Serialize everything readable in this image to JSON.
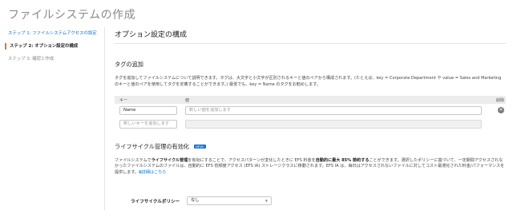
{
  "page": {
    "title": "ファイルシステムの作成"
  },
  "steps": [
    {
      "label": "ステップ 1: ファイルシステムアクセスの設定",
      "state": "link"
    },
    {
      "label": "ステップ 2: オプション設定の構成",
      "state": "active"
    },
    {
      "label": "ステップ 3: 確認と作成",
      "state": "muted"
    }
  ],
  "section": {
    "title": "オプション設定の構成"
  },
  "tags": {
    "title": "タグの追加",
    "description": "タグを追加してファイルシステムについて説明できます。タグは、大文字と小文字が区別されるキーと値のペアから構成されます。(たとえば、key = Corporate Department や value = Sales and Marketing のキーと値のペアを使用してタグを定義することができます。) 最低でも、key = Name のタグをお勧めします。",
    "col_key": "キー",
    "col_value": "値",
    "col_remove": "削除",
    "rows": [
      {
        "key": "Name",
        "value_placeholder": "新しい値を追加します",
        "removable": true
      }
    ],
    "new_key_placeholder": "新しいキーを追加します"
  },
  "lifecycle": {
    "title": "ライフサイクル管理の有効化",
    "badge": "NEW!",
    "desc_1": "ファイルシステムで",
    "desc_bold_1": "ライフサイクル管理",
    "desc_2": "を有効にすることで、アクセスパターンが変化したときに EFS 料金を",
    "desc_bold_2": "自動的に最大 85% 節約する",
    "desc_3": "ことができます。選択したポリシーに基づいて、一定期間アクセスされなかったファイルシステムのファイルは、自動的に EFS 低頻度アクセス (EFS IA) ストレージクラスに移動されます。EFS IA は、毎日はアクセスされないファイルに対してコスト最適化された料金/パフォーマンスを提供します。",
    "learn_more": "詳細はこちら",
    "policy_label": "ライフサイクルポリシー",
    "policy_value": "なし"
  }
}
